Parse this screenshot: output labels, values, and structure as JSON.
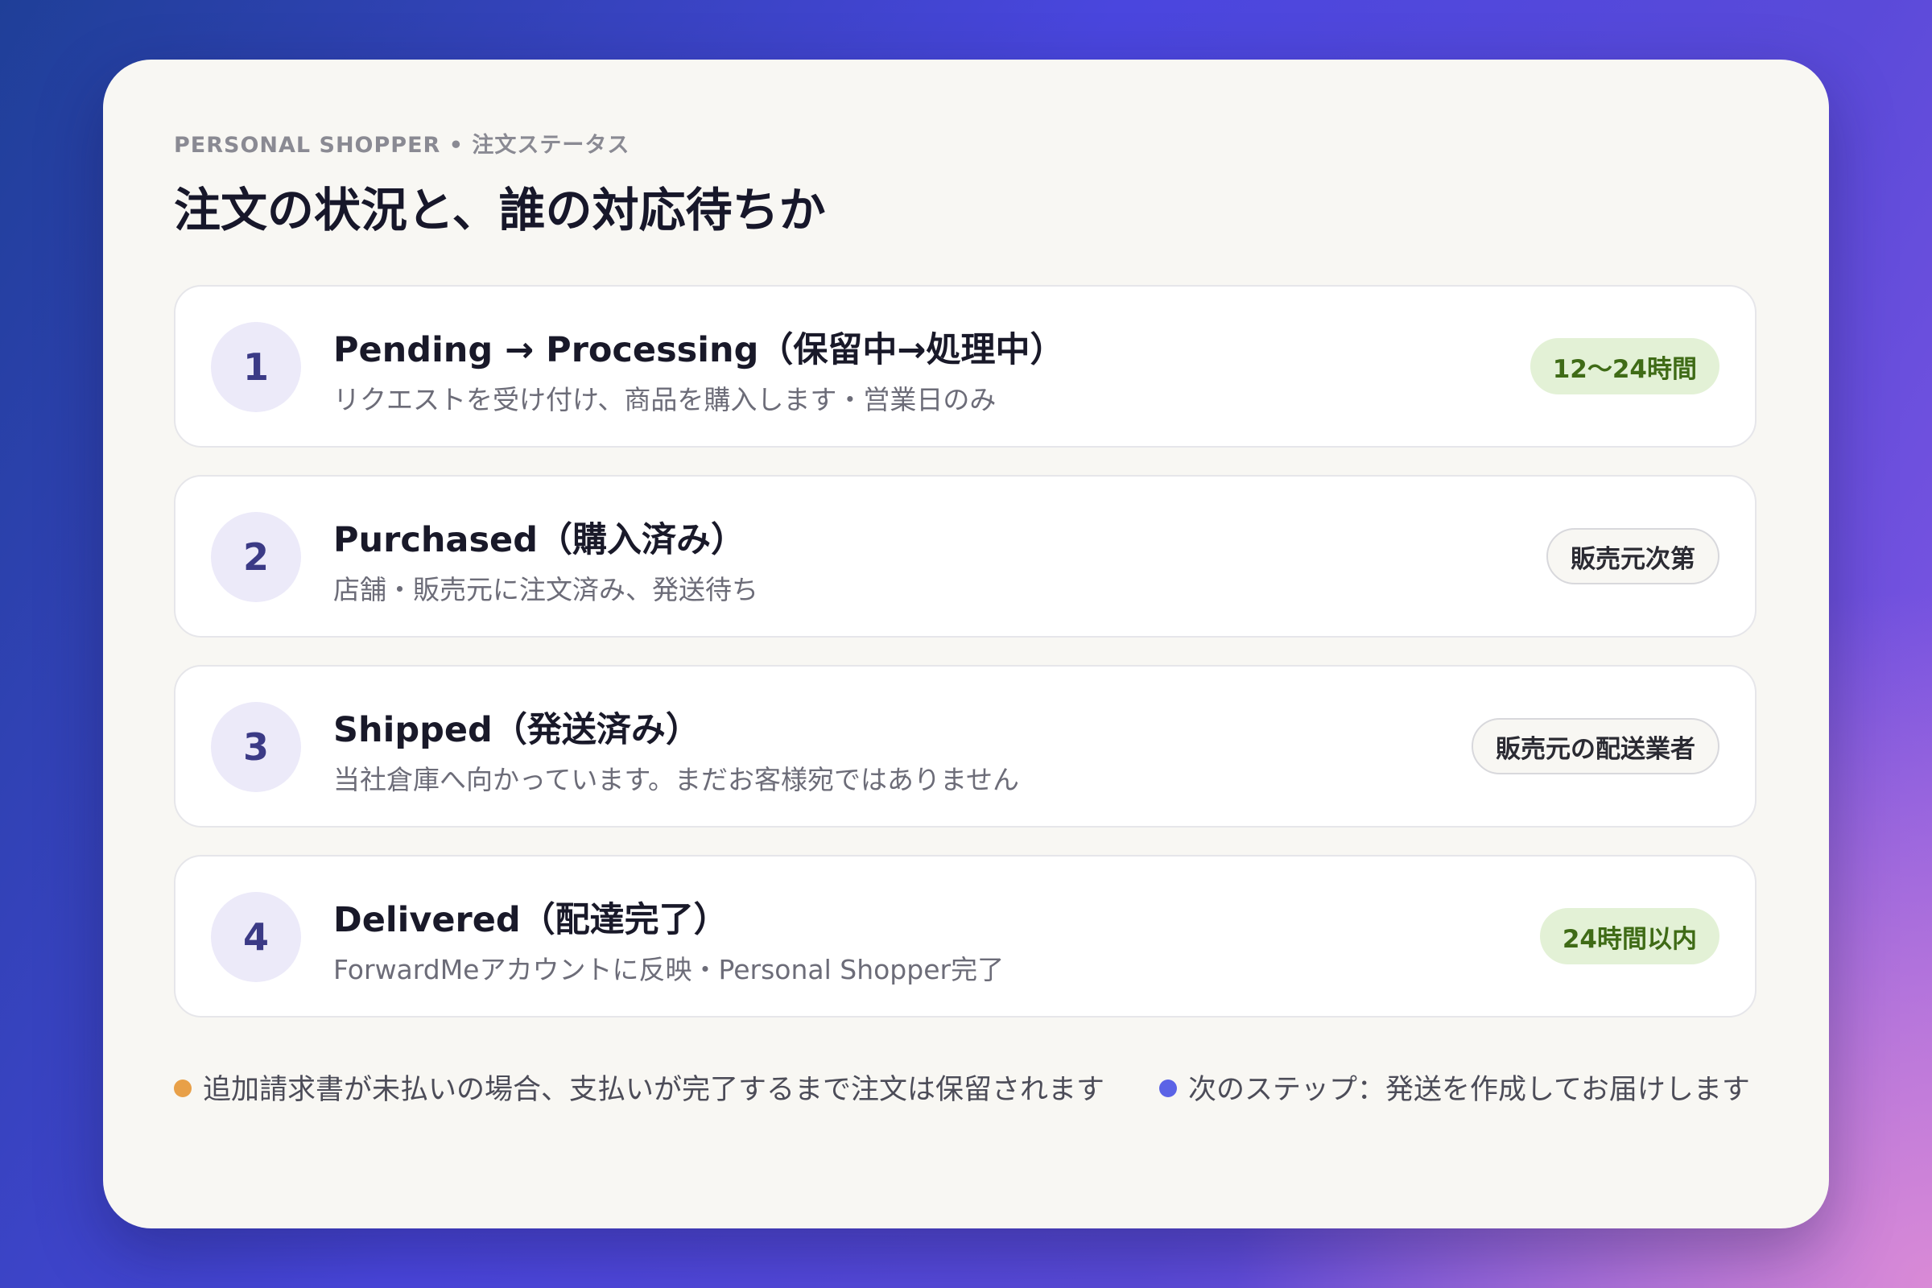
{
  "header": {
    "eyebrow": "PERSONAL SHOPPER • 注文ステータス",
    "title": "注文の状況と、誰の対応待ちか"
  },
  "steps": [
    {
      "number": "1",
      "title": "Pending → Processing（保留中→処理中）",
      "description": "リクエストを受け付け、商品を購入します・営業日のみ",
      "badge": "12〜24時間",
      "badge_style": "green"
    },
    {
      "number": "2",
      "title": "Purchased（購入済み）",
      "description": "店舗・販売元に注文済み、発送待ち",
      "badge": "販売元次第",
      "badge_style": "outline"
    },
    {
      "number": "3",
      "title": "Shipped（発送済み）",
      "description": "当社倉庫へ向かっています。まだお客様宛ではありません",
      "badge": "販売元の配送業者",
      "badge_style": "outline"
    },
    {
      "number": "4",
      "title": "Delivered（配達完了）",
      "description": "ForwardMeアカウントに反映・Personal Shopper完了",
      "badge": "24時間以内",
      "badge_style": "green"
    }
  ],
  "notes": {
    "left": {
      "text": "追加請求書が未払いの場合、支払いが完了するまで注文は保留されます",
      "dot_color": "#e8a048"
    },
    "right": {
      "text": "次のステップ：発送を作成してお届けします",
      "dot_color": "#5b63e6"
    }
  }
}
